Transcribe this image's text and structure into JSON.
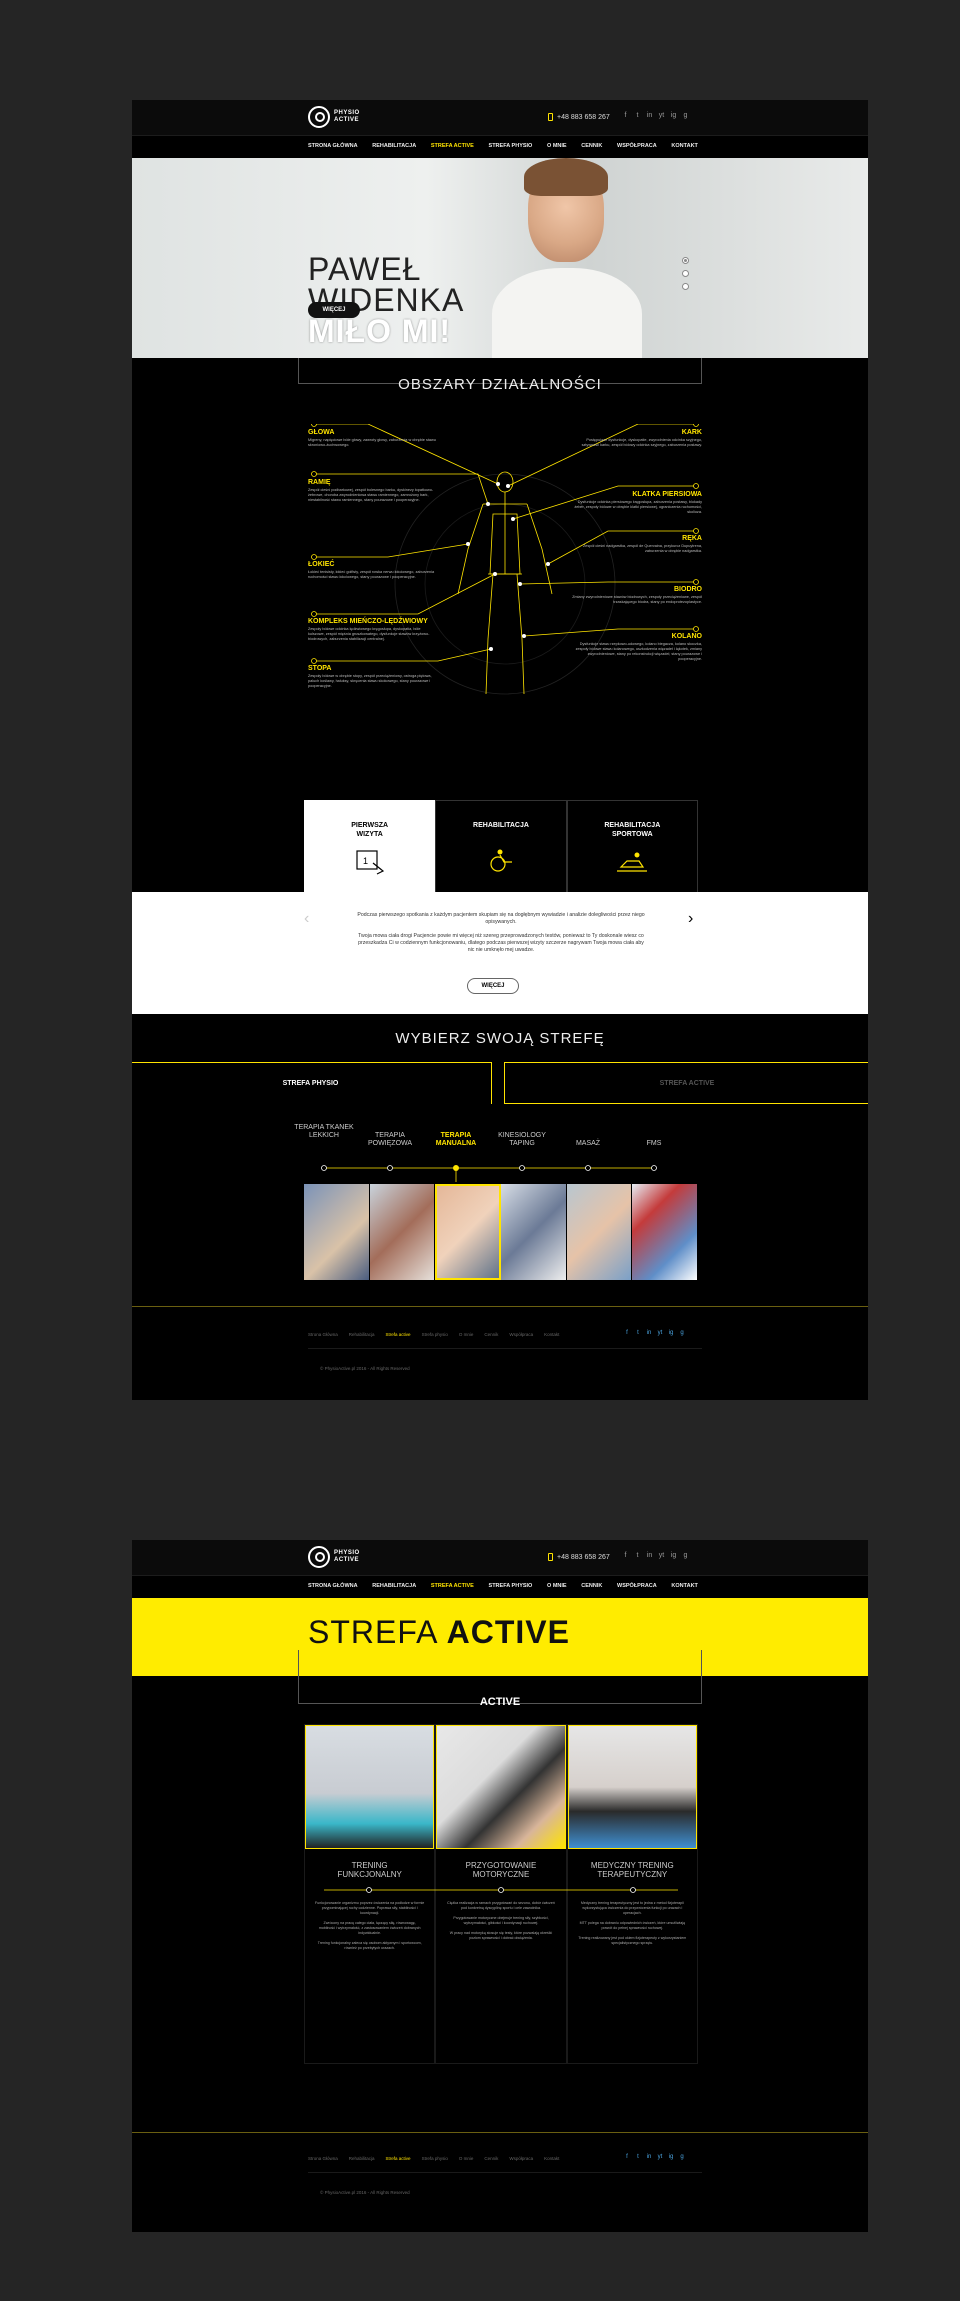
{
  "brand": {
    "line1": "PHYSIO",
    "line2": "ACTIVE"
  },
  "phone": "+48 883 658 267",
  "social": [
    "f",
    "t",
    "in",
    "yt",
    "ig",
    "g"
  ],
  "nav": [
    "STRONA GŁÓWNA",
    "REHABILITACJA",
    "STREFA ACTIVE",
    "STREFA PHYSIO",
    "O MNIE",
    "CENNIK",
    "WSPÓŁPRACA",
    "KONTAKT"
  ],
  "hero": {
    "line1": "PAWEŁ",
    "line2": "WIDENKA",
    "line3": "MIŁO MI!",
    "button": "WIĘCEJ"
  },
  "areas_title": "OBSZARY DZIAŁALNOŚCI",
  "areas": {
    "glowa": {
      "title": "GŁOWA",
      "text": "Migreny, napięciowe bóle głowy, zawroty głowy, zaburzenia w obrębie stawu skroniowo-żuchwowego."
    },
    "ramie": {
      "title": "RAMIĘ",
      "text": "Zespół cieśni podbarkowej, zespół bolesnego barku, dyskinezy łopatkowo-żebrowe, choroba zwyrodnieniowa stawu ramiennego, zamrożony bark, niestabilność stawu ramiennego, stany pourazowe i pooperacyjne."
    },
    "lokiec": {
      "title": "ŁOKIEĆ",
      "text": "Łokieć tenisisty, łokieć golfisty, zespół rowka nerwu łokciowego, zaburzenia ruchomości stawu łokciowego, stany pourazowe i pooperacyjne."
    },
    "kompleks": {
      "title": "KOMPLEKS MIEŃCZO-LĘDŹWIOWY",
      "text": "Zespoły bólowe odcinka lędźwiowego kręgosłupa, dyskopatia, bóle kulszowe, zespół mięśnia gruszkowatego, dysfunkcje stawów krzyżowo-biodrowych, zaburzenia stabilizacji centralnej."
    },
    "stopa": {
      "title": "STOPA",
      "text": "Zespoły bólowe w obrębie stopy, zespół przeciążeniowy, ostroga piętowa, paluch koślawy, haluksy, skręcenia stawu skokowego, stany pourazowe i pooperacyjne."
    },
    "kark": {
      "title": "KARK",
      "text": "Postępujące dysfunkcje, dyskopatie, zwyrodnienia odcinka szyjnego, sztywność karku, zespół bólowy odcinka szyjnego, zaburzenia postawy."
    },
    "klatka": {
      "title": "KLATKA PIERSIOWA",
      "text": "Dysfunkcje odcinka piersiowego kręgosłupa, zaburzenia postawy, blokady żeber, zespoły bólowe w obrębie klatki piersiowej, ograniczenia ruchomości, skolioza."
    },
    "reka": {
      "title": "RĘKA",
      "text": "Zespół cieśni nadgarstka, zespół de Quervaina, przykurcz Dupuytrena, zaburzenia w obrębie nadgarstka."
    },
    "biodro": {
      "title": "BIODRO",
      "text": "Zmiany zwyrodnieniowe stawów biodrowych, zespoły przeciążeniowe, zespół trzaskającego biodra, stany po endoprotezoplastyce."
    },
    "kolano": {
      "title": "KOLANO",
      "text": "Dysfunkcje stawu rzepkowo-udowego, kolano biegacza, kolano skoczka, zespoły bólowe stawu kolanowego, uszkodzenia więzadeł i łąkotek, zmiany zwyrodnieniowe, stany po rekonstrukcji więzadeł, stany pourazowe i pooperacyjne."
    }
  },
  "tiles": [
    {
      "label1": "PIERWSZA",
      "label2": "WIZYTA"
    },
    {
      "label1": "REHABILITACJA",
      "label2": ""
    },
    {
      "label1": "REHABILITACJA",
      "label2": "SPORTOWA"
    }
  ],
  "band": {
    "p1": "Podczas pierwszego spotkania z każdym pacjentem skupiam się na dogłębnym wywiadzie i analizie dolegliwości przez niego opisywanych.",
    "p2": "Twoja mowa ciała drogi Pacjencie powie mi więcej niż szereg przeprowadzonych testów, ponieważ to Ty doskonale wiesz co przeszkadza Ci w codziennym funkcjonowaniu, dlatego podczas pierwszej wizyty szczerze nagrywam Twoja mowa ciała aby nic nie umknęło mej uwadze.",
    "button": "WIĘCEJ"
  },
  "zone_title": "WYBIERZ SWOJĄ STREFĘ",
  "zone_tabs": [
    "STREFA PHYSIO",
    "STREFA ACTIVE"
  ],
  "timeline": [
    "TERAPIA TKANEK LEKKICH",
    "TERAPIA POWIĘZOWA",
    "TERAPIA MANUALNA",
    "KINESIOLOGY TAPING",
    "MASAŻ",
    "FMS"
  ],
  "footer_nav": [
    "Strona Główna",
    "Rehabilitacja",
    "Strefa active",
    "Strefa physio",
    "O mnie",
    "Cennik",
    "Współpraca",
    "Kontakt"
  ],
  "copyright": "© PhysioActive.pl 2016 - All Rights Reserved",
  "active": {
    "title_light": "STREFA",
    "title_bold": "ACTIVE",
    "label": "ACTIVE",
    "cols": [
      {
        "name1": "TRENING",
        "name2": "FUNKCJONALNY",
        "p1": "Funkcjonowanie organizmu poprzez ćwiczenia na podłodze w formie przypominającej ruchy codzienne. Poprawa siły, stabilności i koordynacji.",
        "p2": "Zwrócony na pracę całego ciała, łączący siłę, równowagę, mobilność i wytrzymałość, z zastosowaniem ćwiczeń dobranych indywidualnie.",
        "p3": "Trening funkcjonalny zaleca się osobom aktywnym i sportowcom, również po przebytych urazach."
      },
      {
        "name1": "PRZYGOTOWANIE",
        "name2": "MOTORYCZNE",
        "p1": "Ciężka realizacja w ramach przygotowań do sezonu, dobór ćwiczeń pod konkretną dyscyplinę sportu i cele zawodnika.",
        "p2": "Przygotowanie motoryczne obejmuje trening siły, szybkości, wytrzymałości, gibkości i koordynacji ruchowej.",
        "p3": "W pracy nad motoryką stosuje się testy, które pozwalają określić poziom sprawności i dobrać obciążenia."
      },
      {
        "name1": "MEDYCZNY TRENING",
        "name2": "TERAPEUTYCZNY",
        "p1": "Medyczny trening terapeutyczny jest to jedna z metod fizjoterapii wykorzystująca ćwiczenia do przywrócenia funkcji po urazach i operacjach.",
        "p2": "MTT polega na dobraniu odpowiednich ćwiczeń, które umożliwiają powrót do pełnej sprawności ruchowej.",
        "p3": "Trening realizowany jest pod okiem fizjoterapeuty z wykorzystaniem specjalistycznego sprzętu."
      }
    ]
  },
  "colors": {
    "accent": "#ffe400",
    "bg": "#000000",
    "outer": "#252525"
  }
}
